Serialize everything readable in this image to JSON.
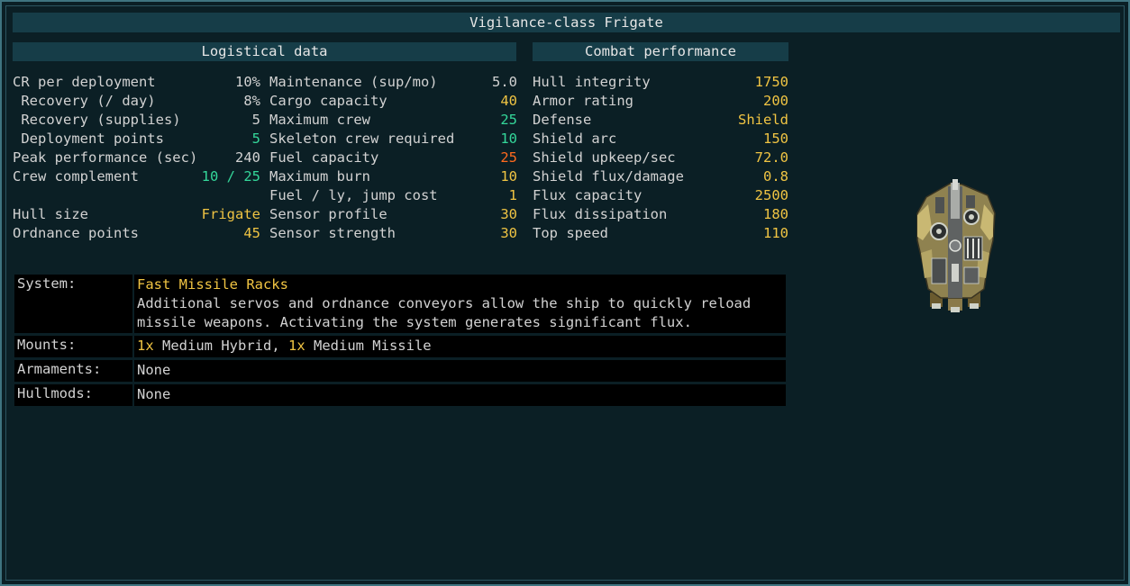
{
  "title": "Vigilance-class Frigate",
  "sections": {
    "logistical": "Logistical data",
    "combat": "Combat performance"
  },
  "col1": [
    {
      "label": "CR per deployment",
      "value": "10%",
      "color": "white"
    },
    {
      "label": " Recovery (/ day)",
      "value": "8%",
      "color": "white"
    },
    {
      "label": " Recovery (supplies)",
      "value": "5",
      "color": "white"
    },
    {
      "label": " Deployment points",
      "value": "5",
      "color": "teal"
    },
    {
      "label": "Peak performance (sec)",
      "value": "240",
      "color": "white"
    },
    {
      "label": "Crew complement",
      "value": "10 / 25",
      "color": "green"
    },
    {
      "label": "",
      "value": "",
      "color": "white"
    },
    {
      "label": "Hull size",
      "value": "Frigate",
      "color": "yellow"
    },
    {
      "label": "Ordnance points",
      "value": "45",
      "color": "yellow"
    }
  ],
  "col2": [
    {
      "label": "Maintenance (sup/mo)",
      "value": "5.0",
      "color": "white"
    },
    {
      "label": "Cargo capacity",
      "value": "40",
      "color": "yellow"
    },
    {
      "label": "Maximum crew",
      "value": "25",
      "color": "teal"
    },
    {
      "label": "Skeleton crew required",
      "value": "10",
      "color": "teal"
    },
    {
      "label": "Fuel capacity",
      "value": "25",
      "color": "orange"
    },
    {
      "label": "Maximum burn",
      "value": "10",
      "color": "yellow"
    },
    {
      "label": "Fuel / ly, jump cost",
      "value": "1",
      "color": "yellow"
    },
    {
      "label": "Sensor profile",
      "value": "30",
      "color": "yellow"
    },
    {
      "label": "Sensor strength",
      "value": "30",
      "color": "yellow"
    }
  ],
  "col3": [
    {
      "label": "Hull integrity",
      "value": "1750",
      "color": "yellow"
    },
    {
      "label": "Armor rating",
      "value": "200",
      "color": "yellow"
    },
    {
      "label": "Defense",
      "value": "Shield",
      "color": "yellow"
    },
    {
      "label": "Shield arc",
      "value": "150",
      "color": "yellow"
    },
    {
      "label": "Shield upkeep/sec",
      "value": "72.0",
      "color": "yellow"
    },
    {
      "label": "Shield flux/damage",
      "value": "0.8",
      "color": "yellow"
    },
    {
      "label": "Flux capacity",
      "value": "2500",
      "color": "yellow"
    },
    {
      "label": "Flux dissipation",
      "value": "180",
      "color": "yellow"
    },
    {
      "label": "Top speed",
      "value": "110",
      "color": "yellow"
    }
  ],
  "info": {
    "system_label": "System:",
    "system_name": "Fast Missile Racks",
    "system_desc_1": "Additional servos and ordnance conveyors allow the ship to quickly reload",
    "system_desc_2": "missile weapons. Activating the system generates significant flux.",
    "mounts_label": "Mounts:",
    "mount1_count": "1x",
    "mount1_name": " Medium Hybrid, ",
    "mount2_count": "1x",
    "mount2_name": " Medium Missile",
    "armaments_label": "Armaments:",
    "armaments_value": "None",
    "hullmods_label": "Hullmods:",
    "hullmods_value": "None"
  },
  "ship_image": "vigilance-frigate-sprite",
  "colors": {
    "background": "#0b1f25",
    "header": "#163d48",
    "border": "#3f7480",
    "text": "#d2d2d2",
    "highlight_yellow": "#f0c443",
    "highlight_green": "#34d79a",
    "highlight_orange": "#ff6a1e"
  }
}
